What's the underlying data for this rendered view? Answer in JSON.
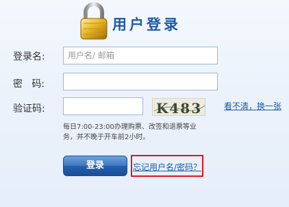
{
  "header": {
    "title": "用户登录",
    "icon": "padlock-icon"
  },
  "form": {
    "username_label": "登录名:",
    "username_placeholder": "用户名/ 邮箱",
    "password_label": "密   码:",
    "captcha_label": "验证码:",
    "captcha_text": "K483",
    "refresh_label": "看不清，换一张",
    "note": "每日7:00-23:00办理购票、改签和退票等业务，并不晚于开车前2小时。"
  },
  "actions": {
    "login_label": "登录",
    "forgot_label": "忘记用户名/密码？"
  },
  "colors": {
    "accent": "#1c5aa6",
    "highlight_border": "#e0141b"
  }
}
